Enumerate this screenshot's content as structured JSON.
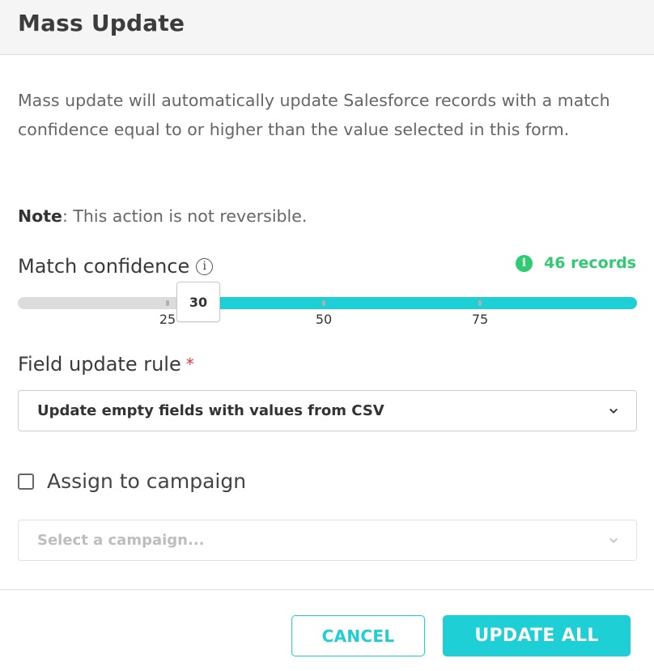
{
  "header": {
    "title": "Mass Update"
  },
  "description": "Mass update will automatically update Salesforce records with a match confidence equal to or higher than the value selected in this form.",
  "note": {
    "label": "Note",
    "text": ": This action is not reversible."
  },
  "match_confidence": {
    "label": "Match confidence",
    "info_icon": "info-outline-icon",
    "records_icon": "info-solid-icon",
    "records_text": "46 records",
    "slider_value": "30",
    "ticks": [
      "25",
      "50",
      "75"
    ]
  },
  "field_update_rule": {
    "label": "Field update rule",
    "required_mark": "*",
    "selected": "Update empty fields with values from CSV"
  },
  "campaign": {
    "checkbox_label": "Assign to campaign",
    "checked": false,
    "placeholder": "Select a campaign..."
  },
  "footer": {
    "cancel_label": "CANCEL",
    "update_label": "UPDATE ALL"
  },
  "colors": {
    "accent": "#1ecfd6",
    "success": "#2ecc71",
    "required": "#e53935"
  }
}
